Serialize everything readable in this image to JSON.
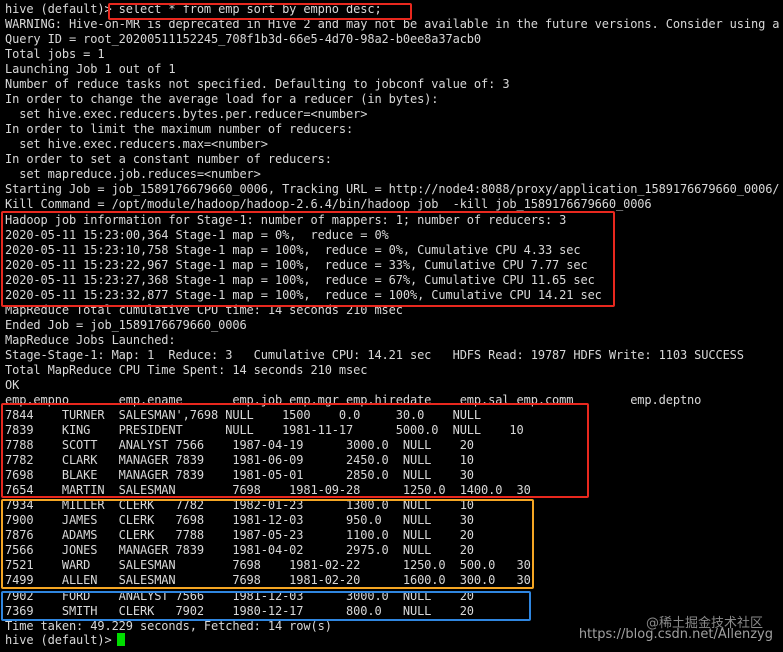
{
  "terminal": {
    "lines": [
      "hive (default)> select * from emp sort by empno desc;",
      "WARNING: Hive-on-MR is deprecated in Hive 2 and may not be available in the future versions. Consider using a d",
      "Query ID = root_20200511152245_708f1b3d-66e5-4d70-98a2-b0ee8a37acb0",
      "Total jobs = 1",
      "Launching Job 1 out of 1",
      "Number of reduce tasks not specified. Defaulting to jobconf value of: 3",
      "In order to change the average load for a reducer (in bytes):",
      "  set hive.exec.reducers.bytes.per.reducer=<number>",
      "In order to limit the maximum number of reducers:",
      "  set hive.exec.reducers.max=<number>",
      "In order to set a constant number of reducers:",
      "  set mapreduce.job.reduces=<number>",
      "Starting Job = job_1589176679660_0006, Tracking URL = http://node4:8088/proxy/application_1589176679660_0006/",
      "Kill Command = /opt/module/hadoop/hadoop-2.6.4/bin/hadoop job  -kill job_1589176679660_0006",
      "Hadoop job information for Stage-1: number of mappers: 1; number of reducers: 3",
      "2020-05-11 15:23:00,364 Stage-1 map = 0%,  reduce = 0%",
      "2020-05-11 15:23:10,758 Stage-1 map = 100%,  reduce = 0%, Cumulative CPU 4.33 sec",
      "2020-05-11 15:23:22,967 Stage-1 map = 100%,  reduce = 33%, Cumulative CPU 7.77 sec",
      "2020-05-11 15:23:27,368 Stage-1 map = 100%,  reduce = 67%, Cumulative CPU 11.65 sec",
      "2020-05-11 15:23:32,877 Stage-1 map = 100%,  reduce = 100%, Cumulative CPU 14.21 sec",
      "MapReduce Total cumulative CPU time: 14 seconds 210 msec",
      "Ended Job = job_1589176679660_0006",
      "MapReduce Jobs Launched:",
      "Stage-Stage-1: Map: 1  Reduce: 3   Cumulative CPU: 14.21 sec   HDFS Read: 19787 HDFS Write: 1103 SUCCESS",
      "Total MapReduce CPU Time Spent: 14 seconds 210 msec",
      "OK",
      "emp.empno       emp.ename       emp.job emp.mgr emp.hiredate    emp.sal emp.comm        emp.deptno",
      "7844    TURNER  SALESMAN',7698 NULL    1500    0.0     30.0    NULL",
      "7839    KING    PRESIDENT      NULL    1981-11-17      5000.0  NULL    10",
      "7788    SCOTT   ANALYST 7566    1987-04-19      3000.0  NULL    20",
      "7782    CLARK   MANAGER 7839    1981-06-09      2450.0  NULL    10",
      "7698    BLAKE   MANAGER 7839    1981-05-01      2850.0  NULL    30",
      "7654    MARTIN  SALESMAN        7698    1981-09-28      1250.0  1400.0  30",
      "7934    MILLER  CLERK   7782    1982-01-23      1300.0  NULL    10",
      "7900    JAMES   CLERK   7698    1981-12-03      950.0   NULL    30",
      "7876    ADAMS   CLERK   7788    1987-05-23      1100.0  NULL    20",
      "7566    JONES   MANAGER 7839    1981-04-02      2975.0  NULL    20",
      "7521    WARD    SALESMAN        7698    1981-02-22      1250.0  500.0   30",
      "7499    ALLEN   SALESMAN        7698    1981-02-20      1600.0  300.0   30",
      "7902    FORD    ANALYST 7566    1981-12-03      3000.0  NULL    20",
      "7369    SMITH   CLERK   7902    1980-12-17      800.0   NULL    20",
      "Time taken: 49.229 seconds, Fetched: 14 row(s)",
      "hive (default)> "
    ]
  },
  "watermark": {
    "line1": "@稀土掘金技术社区",
    "line2": "https://blog.csdn.net/Allenzyg"
  },
  "colors": {
    "background": "#000000",
    "text": "#d8d8d8",
    "cursor": "#00dd00",
    "highlight_red": "#e8281e",
    "highlight_orange": "#f5a623",
    "highlight_blue": "#2f86e0"
  }
}
